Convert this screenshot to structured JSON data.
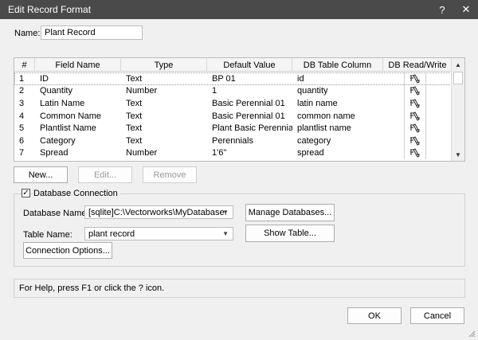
{
  "window": {
    "title": "Edit Record Format",
    "help_glyph": "?",
    "close_glyph": "✕"
  },
  "name_field": {
    "label": "Name:",
    "value": "Plant Record"
  },
  "table": {
    "headers": [
      "#",
      "Field Name",
      "Type",
      "Default Value",
      "DB Table Column",
      "DB Read/Write"
    ],
    "rows": [
      {
        "num": "1",
        "field": "ID",
        "type": "Text",
        "default": "BP 01",
        "column": "id"
      },
      {
        "num": "2",
        "field": "Quantity",
        "type": "Number",
        "default": "1",
        "column": "quantity"
      },
      {
        "num": "3",
        "field": "Latin Name",
        "type": "Text",
        "default": "Basic Perennial 01",
        "column": "latin name"
      },
      {
        "num": "4",
        "field": "Common Name",
        "type": "Text",
        "default": "Basic Perennial 01",
        "column": "common name"
      },
      {
        "num": "5",
        "field": "Plantlist Name",
        "type": "Text",
        "default": "Plant Basic Perennia...",
        "column": "plantlist name"
      },
      {
        "num": "6",
        "field": "Category",
        "type": "Text",
        "default": "Perennials",
        "column": "category"
      },
      {
        "num": "7",
        "field": "Spread",
        "type": "Number",
        "default": "1'6\"",
        "column": "spread"
      }
    ],
    "rw_icon": "pencil-icon"
  },
  "buttons": {
    "new": "New...",
    "edit": "Edit...",
    "remove": "Remove"
  },
  "db": {
    "group_label": "Database Connection",
    "checked": true,
    "db_name_label": "Database Name:",
    "db_name_value": "[sqlite]C:\\Vectorworks\\MyDatabase.",
    "manage_label": "Manage Databases...",
    "table_label": "Table Name:",
    "table_value": "plant record",
    "show_table_label": "Show Table...",
    "connection_options_label": "Connection Options..."
  },
  "help_text": "For Help, press F1 or click the ? icon.",
  "footer": {
    "ok": "OK",
    "cancel": "Cancel"
  }
}
